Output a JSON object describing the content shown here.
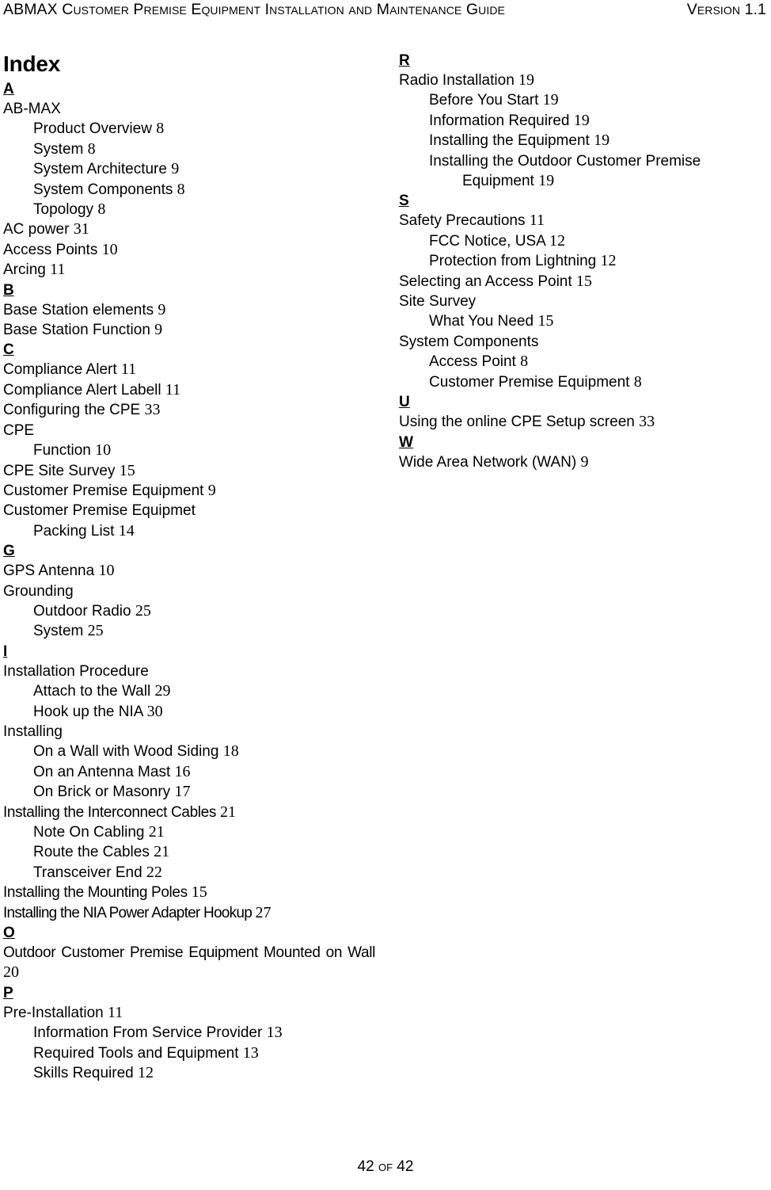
{
  "header": {
    "left": "ABMAX Customer Premise Equipment Installation and Maintenance Guide",
    "right": "Version 1.1"
  },
  "title": "Index",
  "footer": "42 of 42",
  "columns": {
    "left": [
      {
        "type": "letter",
        "label": "A"
      },
      {
        "type": "entry",
        "label": "AB-MAX",
        "page": ""
      },
      {
        "type": "sub",
        "label": "Product Overview",
        "page": "8"
      },
      {
        "type": "sub",
        "label": "System",
        "page": "8"
      },
      {
        "type": "sub",
        "label": "System Architecture",
        "page": "9"
      },
      {
        "type": "sub",
        "label": "System Components",
        "page": "8"
      },
      {
        "type": "sub",
        "label": "Topology",
        "page": "8"
      },
      {
        "type": "entry",
        "label": "AC power",
        "page": "31"
      },
      {
        "type": "entry",
        "label": "Access Points",
        "page": "10"
      },
      {
        "type": "entry",
        "label": "Arcing",
        "page": "11"
      },
      {
        "type": "letter",
        "label": "B"
      },
      {
        "type": "entry",
        "label": "Base Station elements",
        "page": "9"
      },
      {
        "type": "entry",
        "label": "Base Station Function",
        "page": "9"
      },
      {
        "type": "letter",
        "label": "C"
      },
      {
        "type": "entry",
        "label": "Compliance Alert",
        "page": "11"
      },
      {
        "type": "entry",
        "label": "Compliance Alert Labell",
        "page": "11"
      },
      {
        "type": "entry",
        "label": "Configuring the CPE",
        "page": "33"
      },
      {
        "type": "entry",
        "label": "CPE",
        "page": ""
      },
      {
        "type": "sub",
        "label": "Function",
        "page": "10"
      },
      {
        "type": "entry",
        "label": "CPE Site Survey",
        "page": "15"
      },
      {
        "type": "entry",
        "label": "Customer Premise Equipment",
        "page": "9"
      },
      {
        "type": "entry",
        "label": "Customer Premise Equipmet",
        "page": ""
      },
      {
        "type": "sub",
        "label": "Packing List",
        "page": "14"
      },
      {
        "type": "letter",
        "label": "G"
      },
      {
        "type": "entry",
        "label": "GPS Antenna",
        "page": "10"
      },
      {
        "type": "entry",
        "label": "Grounding",
        "page": ""
      },
      {
        "type": "sub",
        "label": "Outdoor Radio",
        "page": "25"
      },
      {
        "type": "sub",
        "label": "System",
        "page": "25"
      },
      {
        "type": "letter",
        "label": "I"
      },
      {
        "type": "entry",
        "label": "Installation Procedure",
        "page": ""
      },
      {
        "type": "sub",
        "label": "Attach to the Wall",
        "page": "29"
      },
      {
        "type": "sub",
        "label": "Hook up the NIA",
        "page": "30"
      },
      {
        "type": "entry",
        "label": "Installing",
        "page": ""
      },
      {
        "type": "sub",
        "label": "On a Wall with Wood Siding",
        "page": "18"
      },
      {
        "type": "sub",
        "label": "On an Antenna Mast",
        "page": "16"
      },
      {
        "type": "sub",
        "label": "On Brick or Masonry",
        "page": "17"
      },
      {
        "type": "entry",
        "label": "Installing the Interconnect Cables",
        "page": "21",
        "fit": "tight"
      },
      {
        "type": "sub",
        "label": "Note On Cabling",
        "page": "21"
      },
      {
        "type": "sub",
        "label": "Route the Cables",
        "page": "21"
      },
      {
        "type": "sub",
        "label": "Transceiver End",
        "page": "22"
      },
      {
        "type": "entry",
        "label": "Installing the Mounting Poles",
        "page": "15",
        "fit": "tight"
      },
      {
        "type": "entry",
        "label": "Installing the NIA Power Adapter Hookup",
        "page": "27",
        "fit": "tight2"
      },
      {
        "type": "letter",
        "label": "O"
      },
      {
        "type": "entrywrap",
        "label": "Outdoor Customer Premise Equipment Mounted on Wall",
        "page": "20",
        "fit": "tight"
      },
      {
        "type": "letter",
        "label": "P"
      },
      {
        "type": "entry",
        "label": "Pre-Installation",
        "page": "11"
      },
      {
        "type": "sub",
        "label": "Information From Service Provider",
        "page": "13"
      },
      {
        "type": "sub",
        "label": "Required Tools and Equipment",
        "page": "13"
      },
      {
        "type": "sub",
        "label": "Skills Required",
        "page": "12"
      }
    ],
    "right": [
      {
        "type": "letter",
        "label": "R"
      },
      {
        "type": "entry",
        "label": "Radio Installation",
        "page": "19"
      },
      {
        "type": "sub",
        "label": "Before You Start",
        "page": "19"
      },
      {
        "type": "sub",
        "label": "Information Required",
        "page": "19"
      },
      {
        "type": "sub",
        "label": "Installing the Equipment",
        "page": "19"
      },
      {
        "type": "subwrap",
        "label": "Installing the Outdoor Customer Premise",
        "cont": "Equipment",
        "page": "19"
      },
      {
        "type": "letter",
        "label": "S"
      },
      {
        "type": "entry",
        "label": "Safety Precautions",
        "page": "11"
      },
      {
        "type": "sub",
        "label": "FCC Notice, USA",
        "page": "12"
      },
      {
        "type": "sub",
        "label": "Protection from Lightning",
        "page": "12"
      },
      {
        "type": "entry",
        "label": "Selecting an Access Point",
        "page": "15"
      },
      {
        "type": "entry",
        "label": "Site Survey",
        "page": ""
      },
      {
        "type": "sub",
        "label": "What You Need",
        "page": "15"
      },
      {
        "type": "entry",
        "label": "System Components",
        "page": ""
      },
      {
        "type": "sub",
        "label": "Access Point",
        "page": "8"
      },
      {
        "type": "sub",
        "label": "Customer Premise Equipment",
        "page": "8"
      },
      {
        "type": "letter",
        "label": "U"
      },
      {
        "type": "entry",
        "label": "Using the online CPE Setup screen",
        "page": "33"
      },
      {
        "type": "letter",
        "label": "W"
      },
      {
        "type": "entry",
        "label": "Wide Area Network (WAN)",
        "page": "9"
      }
    ]
  }
}
